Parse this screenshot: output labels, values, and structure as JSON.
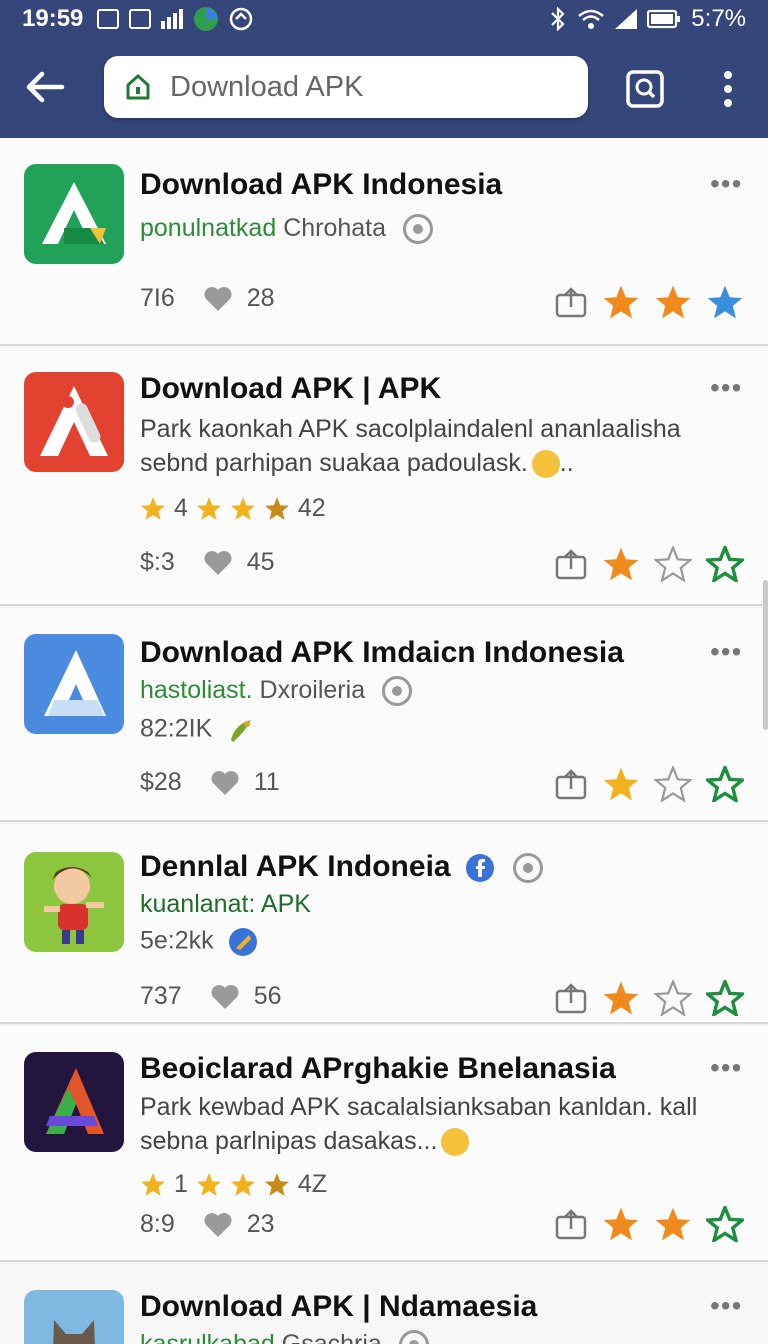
{
  "status": {
    "time": "19:59",
    "battery": "5:7%"
  },
  "search": {
    "value": "",
    "placeholder": "Download APK"
  },
  "apps": [
    {
      "title": "Download APK Indonesia",
      "sub_green": "ponulnatkad",
      "sub_rest": "Chrohata",
      "stat1": "7I6",
      "likes": "28"
    },
    {
      "title": "Download APK | APK",
      "desc1": "Park kaonkah APK sacolplaindalenl ananlaalisha",
      "desc2": "sebnd parhipan suakaa padoulask.",
      "desc2_tail": "..",
      "rating_a": "4",
      "rating_b": "42",
      "stat1": "$:3",
      "likes": "45"
    },
    {
      "title": "Download APK Imdaicn Indonesia",
      "sub_green": "hastoliast.",
      "sub_rest": "Dxroileria",
      "size": "82:2IK",
      "stat1": "$28",
      "likes": "11"
    },
    {
      "title": "Dennlal APK Indoneia",
      "sub_green": "kuanlanat: APK",
      "size": "5e:2kk",
      "stat1": "737",
      "likes": "56"
    },
    {
      "title": "Beoiclarad APrghakie Bnelanasia",
      "desc1": "Park kewbad APK sacalalsianksaban kanldan. kall",
      "desc2": "sebna parlnipas dasakas...",
      "rating_a": "1",
      "rating_b": "4Z",
      "stat1": "8:9",
      "likes": "23"
    },
    {
      "title": "Download APK | Ndamaesia",
      "sub_green": "kasrulkabad",
      "sub_rest": "Gsachria"
    }
  ],
  "more_label": "•••",
  "colors": {
    "toolbar": "#34467a",
    "star_orange": "#f08a1c",
    "star_blue": "#3a8fdc",
    "star_green": "#1f8e3e"
  }
}
